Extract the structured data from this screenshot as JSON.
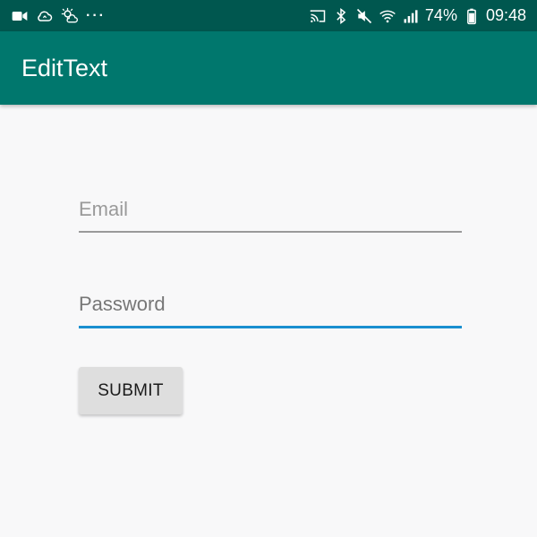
{
  "status_bar": {
    "left_icons": [
      "video-camera-icon",
      "cloud-sync-icon",
      "weather-icon",
      "more-dots-icon"
    ],
    "right_icons": [
      "cast-icon",
      "bluetooth-icon",
      "mute-icon",
      "wifi-icon",
      "signal-icon",
      "battery-icon"
    ],
    "battery_percent": "74%",
    "time": "09:48"
  },
  "app_bar": {
    "title": "EditText",
    "color": "#00776d"
  },
  "form": {
    "email_placeholder": "Email",
    "password_placeholder": "Password",
    "submit_label": "SUBMIT",
    "focus_color": "#1a8fd0"
  }
}
